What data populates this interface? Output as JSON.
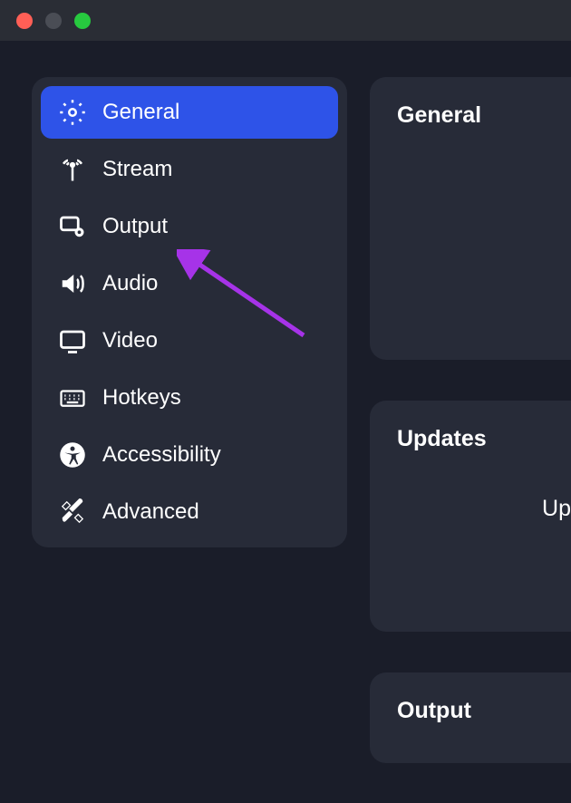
{
  "sidebar": {
    "items": [
      {
        "label": "General",
        "icon": "gear-icon",
        "active": true
      },
      {
        "label": "Stream",
        "icon": "antenna-icon",
        "active": false
      },
      {
        "label": "Output",
        "icon": "output-icon",
        "active": false
      },
      {
        "label": "Audio",
        "icon": "speaker-icon",
        "active": false
      },
      {
        "label": "Video",
        "icon": "monitor-icon",
        "active": false
      },
      {
        "label": "Hotkeys",
        "icon": "keyboard-icon",
        "active": false
      },
      {
        "label": "Accessibility",
        "icon": "accessibility-icon",
        "active": false
      },
      {
        "label": "Advanced",
        "icon": "tools-icon",
        "active": false
      }
    ]
  },
  "panels": {
    "general": {
      "title": "General"
    },
    "updates": {
      "title": "Updates",
      "partial_text": "Up"
    },
    "output": {
      "title": "Output"
    }
  },
  "colors": {
    "accent": "#2e53e8",
    "panel_bg": "#272b38",
    "page_bg": "#1a1d29",
    "arrow": "#a633e8"
  }
}
